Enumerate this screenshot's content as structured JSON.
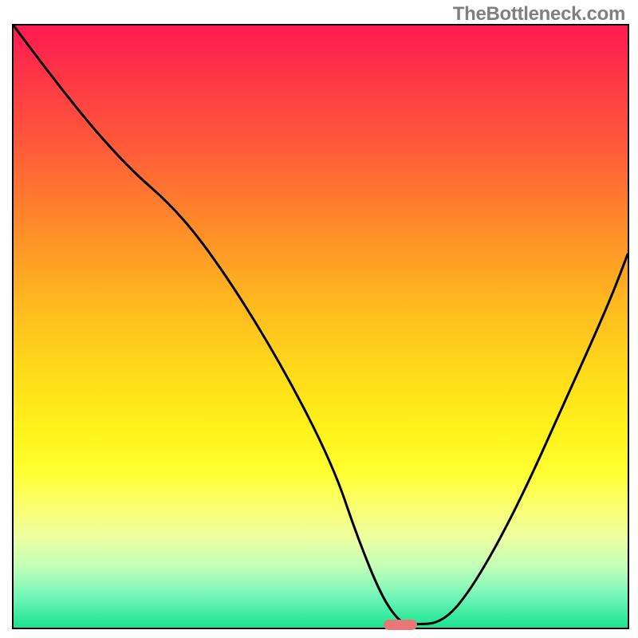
{
  "watermark": "TheBottleneck.com",
  "chart_data": {
    "type": "line",
    "title": "",
    "xlabel": "",
    "ylabel": "",
    "xlim": [
      0,
      100
    ],
    "ylim": [
      0,
      100
    ],
    "grid": false,
    "series": [
      {
        "name": "bottleneck-curve",
        "color": "#000000",
        "x": [
          0,
          8,
          18,
          27,
          35,
          44,
          52,
          56,
          60,
          63,
          65,
          70,
          75,
          82,
          90,
          97,
          100
        ],
        "y": [
          100,
          89,
          77,
          69,
          58,
          43,
          27,
          15,
          5,
          0.8,
          0.5,
          0.8,
          7,
          20,
          38,
          54,
          62
        ]
      }
    ],
    "marker": {
      "x": 63,
      "y": 0.5,
      "width_pct": 5.5,
      "height_pct": 1.7,
      "color": "#e87878"
    },
    "background_gradient": {
      "type": "vertical",
      "stops": [
        {
          "pos": 0.0,
          "color": "#ff1a52"
        },
        {
          "pos": 0.33,
          "color": "#ff8a2a"
        },
        {
          "pos": 0.67,
          "color": "#fff21a"
        },
        {
          "pos": 0.9,
          "color": "#c0ffb8"
        },
        {
          "pos": 1.0,
          "color": "#18e58f"
        }
      ]
    }
  }
}
